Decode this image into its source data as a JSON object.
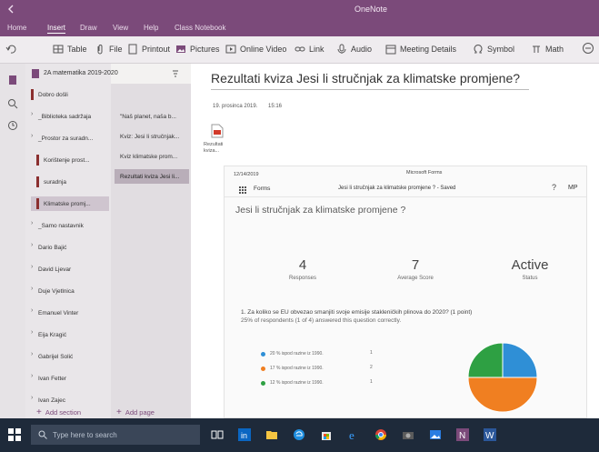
{
  "window": {
    "title": "OneNote"
  },
  "ribbon": {
    "tabs": [
      "Home",
      "Insert",
      "Draw",
      "View",
      "Help",
      "Class Notebook"
    ],
    "active_tab": "Insert",
    "tools": [
      "Table",
      "File",
      "Printout",
      "Pictures",
      "Online Video",
      "Link",
      "Audio",
      "Meeting Details",
      "Symbol",
      "Math"
    ]
  },
  "notebook": {
    "name": "2A matematika 2019-2020"
  },
  "sections": [
    {
      "label": "Dobro došli",
      "color": "#8b2f2f"
    },
    {
      "label": "_Biblioteka sadržaja",
      "color": ""
    },
    {
      "label": "_Prostor za suradn...",
      "color": ""
    },
    {
      "label": "Korištenje prost...",
      "color": "#8b2f2f"
    },
    {
      "label": "suradnja",
      "color": "#8b2f2f"
    },
    {
      "label": "Klimatske promj...",
      "color": "#8b2f2f"
    },
    {
      "label": "_Samo nastavnik",
      "color": ""
    },
    {
      "label": "Dario Bajić",
      "color": ""
    },
    {
      "label": "David Ljevar",
      "color": ""
    },
    {
      "label": "Duje Vjetlnica",
      "color": ""
    },
    {
      "label": "Emanuel Vinter",
      "color": ""
    },
    {
      "label": "Eija Kragić",
      "color": ""
    },
    {
      "label": "Gabrijel Solić",
      "color": ""
    },
    {
      "label": "Ivan Fetter",
      "color": ""
    },
    {
      "label": "Ivan Zajec",
      "color": ""
    }
  ],
  "pages": [
    "\"Naš planet, naša b...",
    "Kviz: Jesi li stručnjak...",
    "Kviz klimatske prom...",
    "Rezultati kviza Jesi li..."
  ],
  "add_section": "Add section",
  "add_page": "Add page",
  "page": {
    "title": "Rezultati kviza Jesi li stručnjak za klimatske promjene?",
    "date": "19. prosinca 2019.",
    "time": "15:16",
    "attachment_label": "Rezultati kviza..."
  },
  "form": {
    "timestamp": "12/14/2019",
    "brand": "Microsoft Forms",
    "app_label": "Forms",
    "name": "Jesi li stručnjak za klimatske promjene ? - Saved",
    "help": "?",
    "initials": "MP",
    "quiz_title": "Jesi li stručnjak za klimatske promjene ?",
    "stats": [
      {
        "value": "4",
        "label": "Responses"
      },
      {
        "value": "7",
        "label": "Average Score"
      },
      {
        "value": "Active",
        "label": "Status"
      }
    ],
    "question": "1. Za koliko se EU obvezao smanjiti svoje emisije stakleničkih plinova do 2020? (1 point)",
    "question_sub": "25% of respondents (1 of 4) answered this question correctly.",
    "legend": [
      {
        "label": "20 % ispod razine iz 1990.",
        "count": "1",
        "color": "#2f8fd6"
      },
      {
        "label": "17 % ispod razine iz 1990.",
        "count": "2",
        "color": "#f07f21"
      },
      {
        "label": "12 % ispod razine iz 1990.",
        "count": "1",
        "color": "#2ea043"
      }
    ]
  },
  "chart_data": {
    "type": "pie",
    "categories": [
      "20 % ispod razine iz 1990.",
      "17 % ispod razine iz 1990.",
      "12 % ispod razine iz 1990."
    ],
    "values": [
      1,
      2,
      1
    ],
    "colors": [
      "#2f8fd6",
      "#f07f21",
      "#2ea043"
    ]
  },
  "taskbar": {
    "search_placeholder": "Type here to search"
  }
}
